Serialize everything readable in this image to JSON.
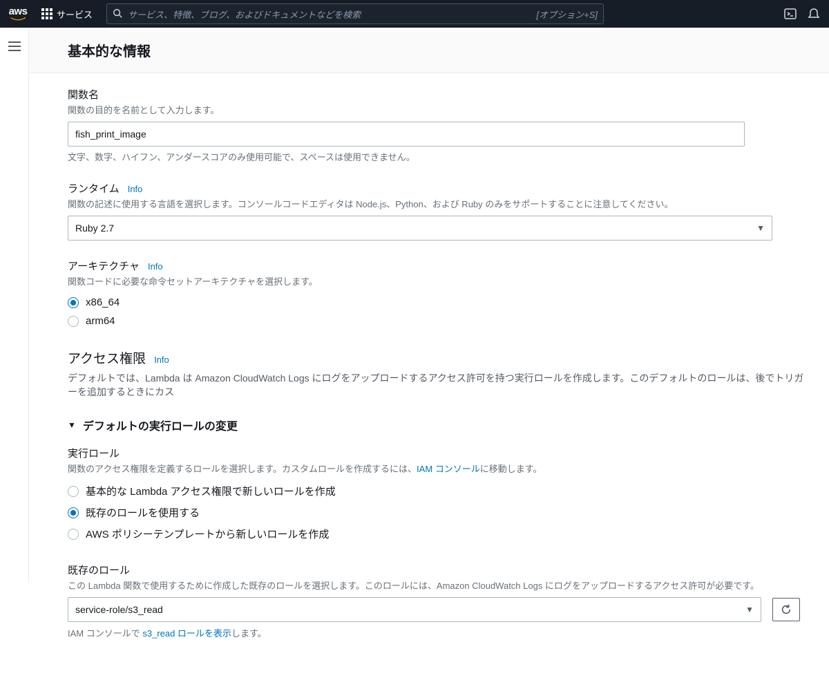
{
  "header": {
    "logo_text": "aws",
    "services_label": "サービス",
    "search_placeholder": "サービス、特徴、ブログ、およびドキュメントなどを検索",
    "search_shortcut": "[オプション+S]"
  },
  "panel": {
    "title": "基本的な情報"
  },
  "function_name": {
    "label": "関数名",
    "desc": "関数の目的を名前として入力します。",
    "value": "fish_print_image",
    "help": "文字、数字、ハイフン、アンダースコアのみ使用可能で、スペースは使用できません。"
  },
  "runtime": {
    "label": "ランタイム",
    "info": "Info",
    "desc": "関数の記述に使用する言語を選択します。コンソールコードエディタは Node.js、Python、および Ruby のみをサポートすることに注意してください。",
    "value": "Ruby 2.7"
  },
  "architecture": {
    "label": "アーキテクチャ",
    "info": "Info",
    "desc": "関数コードに必要な命令セットアーキテクチャを選択します。",
    "options": [
      {
        "value": "x86_64",
        "selected": true
      },
      {
        "value": "arm64",
        "selected": false
      }
    ]
  },
  "permissions": {
    "label": "アクセス権限",
    "info": "Info",
    "desc": "デフォルトでは、Lambda は Amazon CloudWatch Logs にログをアップロードするアクセス許可を持つ実行ロールを作成します。このデフォルトのロールは、後でトリガーを追加するときにカス"
  },
  "expand": {
    "label": "デフォルトの実行ロールの変更"
  },
  "exec_role": {
    "label": "実行ロール",
    "desc_pre": "関数のアクセス権限を定義するロールを選択します。カスタムロールを作成するには、",
    "desc_link": "IAM コンソール",
    "desc_post": "に移動します。",
    "options": [
      {
        "label": "基本的な Lambda アクセス権限で新しいロールを作成",
        "selected": false
      },
      {
        "label": "既存のロールを使用する",
        "selected": true
      },
      {
        "label": "AWS ポリシーテンプレートから新しいロールを作成",
        "selected": false
      }
    ]
  },
  "existing_role": {
    "label": "既存のロール",
    "desc": "この Lambda 関数で使用するために作成した既存のロールを選択します。このロールには、Amazon CloudWatch Logs にログをアップロードするアクセス許可が必要です。",
    "value": "service-role/s3_read",
    "view_pre": "IAM コンソールで ",
    "view_link": "s3_read ロールを表示",
    "view_post": "します。"
  }
}
